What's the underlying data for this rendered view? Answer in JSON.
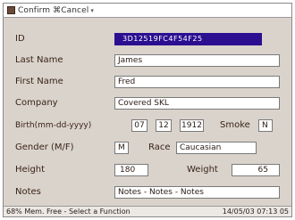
{
  "window": {
    "title": "Confirm ⌘Cancel",
    "colors": {
      "background": "#d9d3cc",
      "highlight": "#2b0f91",
      "label_text": "#3b2416"
    }
  },
  "form": {
    "id": {
      "label": "ID",
      "value": "3D12519FC4F54F25"
    },
    "last_name": {
      "label": "Last Name",
      "value": "James"
    },
    "first_name": {
      "label": "First Name",
      "value": "Fred"
    },
    "company": {
      "label": "Company",
      "value": "Covered SKL"
    },
    "birth": {
      "label": "Birth(mm-dd-yyyy)",
      "month": "07",
      "day": "12",
      "year": "1912"
    },
    "smoke": {
      "label": "Smoke",
      "value": "N"
    },
    "gender": {
      "label": "Gender (M/F)",
      "value": "M"
    },
    "race": {
      "label": "Race",
      "value": "Caucasian"
    },
    "height": {
      "label": "Height",
      "value": "180"
    },
    "weight": {
      "label": "Weight",
      "value": "65"
    },
    "notes": {
      "label": "Notes",
      "value": "Notes - Notes - Notes"
    }
  },
  "status": {
    "left": "68% Mem. Free - Select a Function",
    "right": "14/05/03 07:13 05"
  }
}
